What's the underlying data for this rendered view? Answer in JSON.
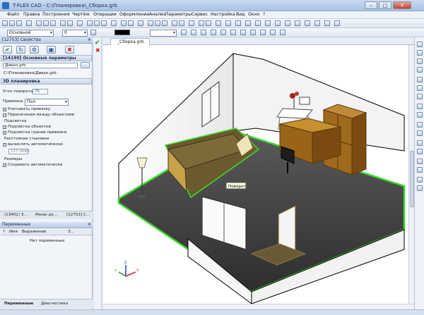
{
  "window": {
    "title": "T-FLEX CAD - C:\\Планировка\\_Сборка.grb",
    "min": "–",
    "max": "□",
    "close": "✕"
  },
  "menu": [
    "Файл",
    "Правка",
    "Построения",
    "Чертёж",
    "Операции",
    "Оформление",
    "Анализ",
    "Параметры",
    "Сервис",
    "Настройка",
    "Вид",
    "Окно",
    "?"
  ],
  "toolbar2": {
    "layer": "Основной",
    "layer_num": "0"
  },
  "properties_panel": {
    "title": "[12753] Свойства",
    "close": "✕",
    "section_main": "[14190] Основные параметры",
    "file_name": "Диван.grb",
    "file_path": "C:\\Планировка\\Диван.grb",
    "browse": "...",
    "section_3d": "3D планировка",
    "rotation_label": "Угол поворота:",
    "rotation_value": "75",
    "snap_label": "Привязка:",
    "snap_value": "Пол",
    "chk_snap": "Учитывать привязку",
    "chk_intersect": "Пересечения между объектами",
    "group_highlight": "Подсветка",
    "chk_highlight_obj": "Подсветка объектов",
    "chk_highlight_faces": "Подсветка граней привязки",
    "group_dist": "Расстояние стыковки",
    "chk_dist_auto": "вычислять автоматически",
    "dist_value": "127.0083",
    "group_dims": "Размеры",
    "chk_dims_auto": "Создавать автоматически"
  },
  "panel_tabs": [
    "(13402) З...",
    "Меню до...",
    "[12753] С..."
  ],
  "variables_panel": {
    "title": "Переменные",
    "cols": [
      "?",
      "Имя",
      "Выражение",
      "З..."
    ],
    "empty": "Нет переменных"
  },
  "bottom_tabs": {
    "vars": "Переменные",
    "diag": "Диагностика"
  },
  "document": {
    "tab": "_Сборка.grb",
    "tooltip": "Поворот"
  },
  "axes": {
    "x": "X",
    "y": "Y",
    "z": "Z"
  },
  "colors": {
    "floor": "#3a3a3a",
    "selection": "#3adf2e",
    "wood": "#9a6a1c",
    "sofa": "#6b5a2e"
  }
}
